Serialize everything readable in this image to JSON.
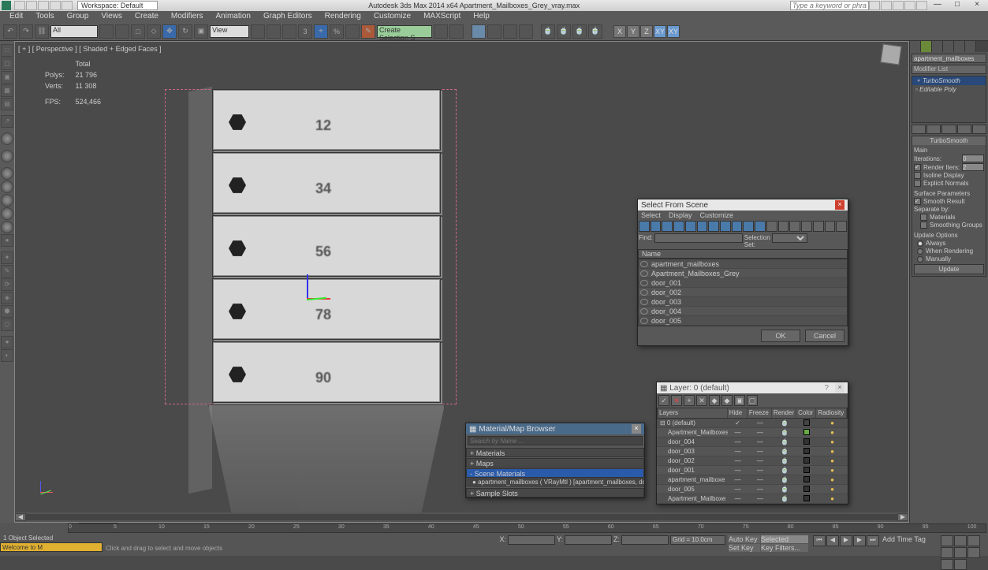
{
  "titlebar": {
    "workspace_label": "Workspace: Default",
    "center_text": "Autodesk 3ds Max  2014 x64    Apartment_Mailboxes_Grey_vray.max",
    "search_placeholder": "Type a keyword or phrase",
    "minimize": "—",
    "maximize": "□",
    "close": "×"
  },
  "menubar": [
    "Edit",
    "Tools",
    "Group",
    "Views",
    "Create",
    "Modifiers",
    "Animation",
    "Graph Editors",
    "Rendering",
    "Customize",
    "MAXScript",
    "Help"
  ],
  "maintoolbar": {
    "select_filter": "All",
    "view_drop": "View",
    "create_sel_set": "Create Selection S",
    "axes": [
      "X",
      "Y",
      "Z",
      "XY",
      "XY"
    ]
  },
  "viewport": {
    "label": "[ + ] [ Perspective ] [ Shaded + Edged Faces ]",
    "stats": {
      "total_label": "Total",
      "polys_label": "Polys:",
      "polys": "21 796",
      "verts_label": "Verts:",
      "verts": "11 308",
      "fps_label": "FPS:",
      "fps": "524,466"
    },
    "drawers": [
      "12",
      "34",
      "56",
      "78",
      "90"
    ],
    "slider": "0 / 100",
    "timeline_ticks": [
      "0",
      "5",
      "10",
      "15",
      "20",
      "25",
      "30",
      "35",
      "40",
      "45",
      "50",
      "55",
      "60",
      "65",
      "70",
      "75",
      "80",
      "85",
      "90",
      "95",
      "100"
    ]
  },
  "right_panel": {
    "object_name": "apartment_mailboxes",
    "modifier_list": "Modifier List",
    "stack": [
      "TurboSmooth",
      "Editable Poly"
    ],
    "rollout_title": "TurboSmooth",
    "main_label": "Main",
    "iterations_label": "Iterations:",
    "iterations": "0",
    "render_iters_label": "Render Iters:",
    "render_iters": "2",
    "isoline": "Isoline Display",
    "explicit": "Explicit Normals",
    "surf_params": "Surface Parameters",
    "smooth_result": "Smooth Result",
    "separate": "Separate by:",
    "materials": "Materials",
    "smoothing_groups": "Smoothing Groups",
    "update_options": "Update Options",
    "always": "Always",
    "when_rendering": "When Rendering",
    "manually": "Manually",
    "update_btn": "Update"
  },
  "dlg_sfs": {
    "title": "Select From Scene",
    "menu": [
      "Select",
      "Display",
      "Customize"
    ],
    "find_label": "Find:",
    "selection_set_label": "Selection Set:",
    "header": "Name",
    "items": [
      "apartment_mailboxes",
      "Apartment_Mailboxes_Grey",
      "door_001",
      "door_002",
      "door_003",
      "door_004",
      "door_005"
    ],
    "ok": "OK",
    "cancel": "Cancel"
  },
  "dlg_mat": {
    "title": "Material/Map Browser",
    "search_placeholder": "Search by Name ...",
    "cats": [
      "+ Materials",
      "+ Maps",
      "- Scene Materials"
    ],
    "item": "apartment_mailboxes ( VRayMtl ) [apartment_mailboxes, door_",
    "item_tag": "...",
    "sample_slots": "+ Sample Slots"
  },
  "dlg_layer": {
    "title": "Layer: 0 (default)",
    "headers": [
      "Layers",
      "Hide",
      "Freeze",
      "Render",
      "Color",
      "Radiosity"
    ],
    "rows": [
      {
        "name": "0 (default)",
        "indent": false,
        "color": "#444"
      },
      {
        "name": "Apartment_Mailboxes_G",
        "indent": true,
        "color": "#6a4"
      },
      {
        "name": "door_004",
        "indent": true,
        "color": "#333"
      },
      {
        "name": "door_003",
        "indent": true,
        "color": "#333"
      },
      {
        "name": "door_002",
        "indent": true,
        "color": "#333"
      },
      {
        "name": "door_001",
        "indent": true,
        "color": "#333"
      },
      {
        "name": "apartment_mailboxe",
        "indent": true,
        "color": "#333"
      },
      {
        "name": "door_005",
        "indent": true,
        "color": "#333"
      },
      {
        "name": "Apartment_Mailboxe",
        "indent": true,
        "color": "#333"
      }
    ]
  },
  "statusbar": {
    "welcome": "Welcome to M",
    "selected": "1 Object Selected",
    "prompt": "Click and drag to select and move objects",
    "x_label": "X:",
    "y_label": "Y:",
    "z_label": "Z:",
    "grid": "Grid = 10.0cm",
    "autokey": "Auto Key",
    "setkey": "Set Key",
    "selected_drop": "Selected",
    "keyfilters": "Key Filters...",
    "addtimetag": "Add Time Tag"
  }
}
